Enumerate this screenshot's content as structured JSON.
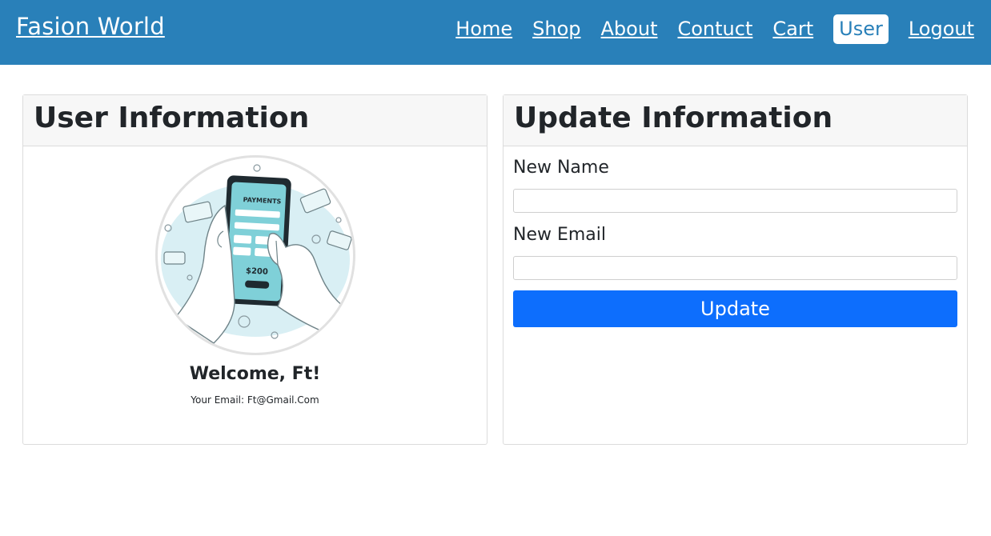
{
  "navbar": {
    "brand": "Fasion World",
    "links": [
      {
        "label": "Home"
      },
      {
        "label": "Shop"
      },
      {
        "label": "About"
      },
      {
        "label": "Contuct"
      },
      {
        "label": "Cart"
      },
      {
        "label": "User",
        "active": true
      },
      {
        "label": "Logout"
      }
    ],
    "colors": {
      "background": "#2980b9",
      "text": "#ffffff"
    }
  },
  "user_card": {
    "title": "User Information",
    "avatar_icon": "payment-phone-illustration",
    "illustration_text": {
      "screen_title": "PAYMENTS",
      "amount": "$200"
    },
    "welcome": "Welcome, Ft!",
    "email_line": "Your Email: Ft@Gmail.Com"
  },
  "update_card": {
    "title": "Update Information",
    "name_label": "New Name",
    "name_value": "",
    "email_label": "New Email",
    "email_value": "",
    "button_label": "Update",
    "button_color": "#0d6efd"
  }
}
